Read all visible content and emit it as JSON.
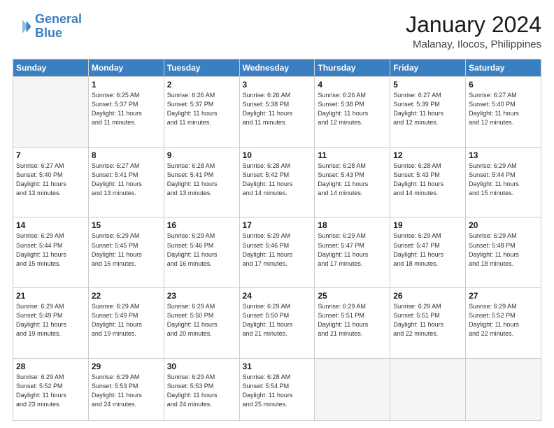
{
  "logo": {
    "line1": "General",
    "line2": "Blue"
  },
  "header": {
    "month": "January 2024",
    "location": "Malanay, Ilocos, Philippines"
  },
  "days_of_week": [
    "Sunday",
    "Monday",
    "Tuesday",
    "Wednesday",
    "Thursday",
    "Friday",
    "Saturday"
  ],
  "weeks": [
    [
      {
        "day": "",
        "info": ""
      },
      {
        "day": "1",
        "info": "Sunrise: 6:25 AM\nSunset: 5:37 PM\nDaylight: 11 hours\nand 11 minutes."
      },
      {
        "day": "2",
        "info": "Sunrise: 6:26 AM\nSunset: 5:37 PM\nDaylight: 11 hours\nand 11 minutes."
      },
      {
        "day": "3",
        "info": "Sunrise: 6:26 AM\nSunset: 5:38 PM\nDaylight: 11 hours\nand 11 minutes."
      },
      {
        "day": "4",
        "info": "Sunrise: 6:26 AM\nSunset: 5:38 PM\nDaylight: 11 hours\nand 12 minutes."
      },
      {
        "day": "5",
        "info": "Sunrise: 6:27 AM\nSunset: 5:39 PM\nDaylight: 11 hours\nand 12 minutes."
      },
      {
        "day": "6",
        "info": "Sunrise: 6:27 AM\nSunset: 5:40 PM\nDaylight: 11 hours\nand 12 minutes."
      }
    ],
    [
      {
        "day": "7",
        "info": "Sunrise: 6:27 AM\nSunset: 5:40 PM\nDaylight: 11 hours\nand 13 minutes."
      },
      {
        "day": "8",
        "info": "Sunrise: 6:27 AM\nSunset: 5:41 PM\nDaylight: 11 hours\nand 13 minutes."
      },
      {
        "day": "9",
        "info": "Sunrise: 6:28 AM\nSunset: 5:41 PM\nDaylight: 11 hours\nand 13 minutes."
      },
      {
        "day": "10",
        "info": "Sunrise: 6:28 AM\nSunset: 5:42 PM\nDaylight: 11 hours\nand 14 minutes."
      },
      {
        "day": "11",
        "info": "Sunrise: 6:28 AM\nSunset: 5:43 PM\nDaylight: 11 hours\nand 14 minutes."
      },
      {
        "day": "12",
        "info": "Sunrise: 6:28 AM\nSunset: 5:43 PM\nDaylight: 11 hours\nand 14 minutes."
      },
      {
        "day": "13",
        "info": "Sunrise: 6:29 AM\nSunset: 5:44 PM\nDaylight: 11 hours\nand 15 minutes."
      }
    ],
    [
      {
        "day": "14",
        "info": "Sunrise: 6:29 AM\nSunset: 5:44 PM\nDaylight: 11 hours\nand 15 minutes."
      },
      {
        "day": "15",
        "info": "Sunrise: 6:29 AM\nSunset: 5:45 PM\nDaylight: 11 hours\nand 16 minutes."
      },
      {
        "day": "16",
        "info": "Sunrise: 6:29 AM\nSunset: 5:46 PM\nDaylight: 11 hours\nand 16 minutes."
      },
      {
        "day": "17",
        "info": "Sunrise: 6:29 AM\nSunset: 5:46 PM\nDaylight: 11 hours\nand 17 minutes."
      },
      {
        "day": "18",
        "info": "Sunrise: 6:29 AM\nSunset: 5:47 PM\nDaylight: 11 hours\nand 17 minutes."
      },
      {
        "day": "19",
        "info": "Sunrise: 6:29 AM\nSunset: 5:47 PM\nDaylight: 11 hours\nand 18 minutes."
      },
      {
        "day": "20",
        "info": "Sunrise: 6:29 AM\nSunset: 5:48 PM\nDaylight: 11 hours\nand 18 minutes."
      }
    ],
    [
      {
        "day": "21",
        "info": "Sunrise: 6:29 AM\nSunset: 5:49 PM\nDaylight: 11 hours\nand 19 minutes."
      },
      {
        "day": "22",
        "info": "Sunrise: 6:29 AM\nSunset: 5:49 PM\nDaylight: 11 hours\nand 19 minutes."
      },
      {
        "day": "23",
        "info": "Sunrise: 6:29 AM\nSunset: 5:50 PM\nDaylight: 11 hours\nand 20 minutes."
      },
      {
        "day": "24",
        "info": "Sunrise: 6:29 AM\nSunset: 5:50 PM\nDaylight: 11 hours\nand 21 minutes."
      },
      {
        "day": "25",
        "info": "Sunrise: 6:29 AM\nSunset: 5:51 PM\nDaylight: 11 hours\nand 21 minutes."
      },
      {
        "day": "26",
        "info": "Sunrise: 6:29 AM\nSunset: 5:51 PM\nDaylight: 11 hours\nand 22 minutes."
      },
      {
        "day": "27",
        "info": "Sunrise: 6:29 AM\nSunset: 5:52 PM\nDaylight: 11 hours\nand 22 minutes."
      }
    ],
    [
      {
        "day": "28",
        "info": "Sunrise: 6:29 AM\nSunset: 5:52 PM\nDaylight: 11 hours\nand 23 minutes."
      },
      {
        "day": "29",
        "info": "Sunrise: 6:29 AM\nSunset: 5:53 PM\nDaylight: 11 hours\nand 24 minutes."
      },
      {
        "day": "30",
        "info": "Sunrise: 6:29 AM\nSunset: 5:53 PM\nDaylight: 11 hours\nand 24 minutes."
      },
      {
        "day": "31",
        "info": "Sunrise: 6:28 AM\nSunset: 5:54 PM\nDaylight: 11 hours\nand 25 minutes."
      },
      {
        "day": "",
        "info": ""
      },
      {
        "day": "",
        "info": ""
      },
      {
        "day": "",
        "info": ""
      }
    ]
  ]
}
